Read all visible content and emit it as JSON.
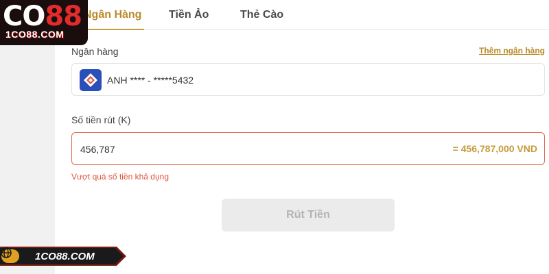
{
  "tabs": [
    {
      "label": "Ngân Hàng",
      "active": true
    },
    {
      "label": "Tiền Ảo",
      "active": false
    },
    {
      "label": "Thẻ Cào",
      "active": false
    }
  ],
  "bank": {
    "label": "Ngân hàng",
    "add_link": "Thêm ngân hàng",
    "account": "ANH **** - *****5432",
    "logo_icon": "bank-logo-icon"
  },
  "amount": {
    "label": "Số tiền rút (K)",
    "value": "456,787",
    "converted": "= 456,787,000 VND",
    "error": "Vượt quá số tiền khả dụng"
  },
  "submit_label": "Rút Tiền",
  "brand": {
    "logo_text_main": "CO",
    "logo_text_accent": "88",
    "logo_sub": "1CO88.COM",
    "banner_text": "1CO88.COM"
  },
  "colors": {
    "accent": "#c79a3a",
    "error": "#e0533a",
    "disabled_button": "#ebebeb",
    "bank_logo_bg": "#2a4fb8"
  }
}
